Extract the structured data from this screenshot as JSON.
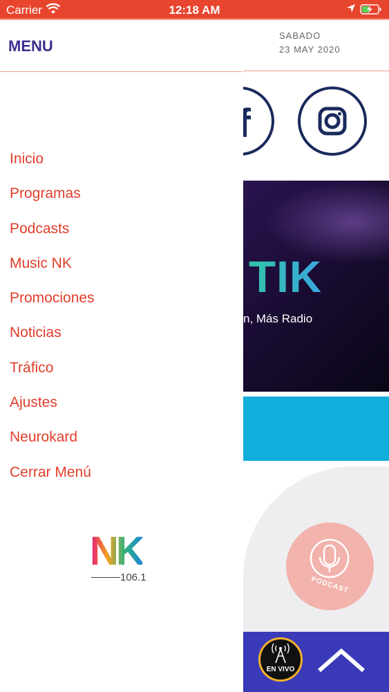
{
  "status_bar": {
    "carrier": "Carrier",
    "time": "12:18 AM"
  },
  "drawer": {
    "title": "MENU",
    "items": [
      {
        "label": "Inicio"
      },
      {
        "label": "Programas"
      },
      {
        "label": "Podcasts"
      },
      {
        "label": "Music NK"
      },
      {
        "label": "Promociones"
      },
      {
        "label": "Noticias"
      },
      {
        "label": "Tráfico"
      },
      {
        "label": "Ajustes"
      },
      {
        "label": "Neurokard"
      },
      {
        "label": "Cerrar Menú"
      }
    ],
    "logo": {
      "text": "NK",
      "frequency": "106.1"
    }
  },
  "background": {
    "date_day": "SABADO",
    "date_full": "23 MAY 2020",
    "social_icons": [
      "facebook-icon",
      "instagram-icon"
    ],
    "banner": {
      "title": "TIK",
      "subtitle": "n, Más Radio"
    },
    "podcast_label": "PODCAST",
    "live_label": "EN VIVO"
  },
  "colors": {
    "status_bar": "#e8452f",
    "menu_title": "#3b2f8f",
    "menu_item": "#e03e2b",
    "bottom_bar": "#3a3ab8",
    "cyan_block": "#11aedb",
    "podcast_button": "#f2b3ac"
  }
}
